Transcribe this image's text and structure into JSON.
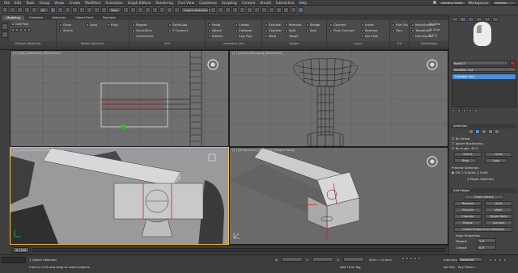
{
  "menubar": {
    "items": [
      "File",
      "Edit",
      "Tools",
      "Group",
      "Views",
      "Create",
      "Modifiers",
      "Animation",
      "Graph Editors",
      "Rendering",
      "Civil View",
      "Customize",
      "Scripting",
      "Content",
      "Arnold",
      "Interactive",
      "Help"
    ],
    "user": "Dmitriy Sivak",
    "workspaces_label": "Workspaces:",
    "workspace": "Default"
  },
  "toolbar": {
    "view_dropdown": "View",
    "selection_set": "Create Selection Se"
  },
  "tabs": [
    "Modeling",
    "Freeform",
    "Selection",
    "Object Paint",
    "Populate"
  ],
  "ribbon": {
    "edit_poly": "Edit Poly",
    "polygon_modeling": "Polygon Modeling",
    "modify_selection_caption": "Modify Selection",
    "edit_caption": "Edit",
    "geometry_caption": "Geometry (All)",
    "edges_caption": "Edges",
    "loops_caption": "Loops",
    "tris_caption": "Tris",
    "subdivision_caption": "Subdivision",
    "align_caption": "Align",
    "grow": "Grow",
    "shrink": "Shrink",
    "loop": "Loop",
    "ring": "Ring",
    "repeat": "Repeat",
    "quickslice": "QuickSlice",
    "swiftloop": "SwiftLoop",
    "p_connect": "P Connect",
    "constraints": "Constraints",
    "relax": "Relax",
    "cut": "Cut",
    "attach": "Attach",
    "detach": "Detach",
    "create": "Create",
    "collapse": "Collapse",
    "cap_poly": "Cap Poly",
    "extrude": "Extrude",
    "chamfer": "Chamfer",
    "weld": "Weld",
    "remove": "Remove",
    "split": "Split",
    "target": "Target",
    "bridge": "Bridge",
    "spin": "Spin",
    "flow_connect": "Flow Connect",
    "connect": "Connect",
    "insert": "Insert",
    "remove_loop": "Remove",
    "set_flow": "Set Flow",
    "edit_tris": "Edit Tris",
    "turn": "Turn",
    "meshsmooth": "MeshSmooth",
    "tessellate": "Tessellate",
    "use_displace": "Use Displac...",
    "make_planar": "Make Planar",
    "to_view": "To View",
    "to_grid": "To Grid",
    "xyz": "X Y Z"
  },
  "viewports": {
    "top_left_label": "[+] [Top] [Standard] [Wireframe]",
    "top_right_label": "[+] [Front] [Standard] [Wireframe]",
    "bottom_left_label": "[+] [Left] [Standard] [Edged Faces]",
    "bottom_right_label": "[+] [Perspective] [Standard] [Edged Faces]"
  },
  "command_panel": {
    "object_name": "Box017",
    "modifier_list_label": "Modifier List",
    "stack_item": "Editable Poly",
    "selection_header": "Selection",
    "by_vertex": "By Vertex",
    "ignore_backfacing": "Ignore Backfacing",
    "by_angle": "By Angle:",
    "by_angle_value": "45.0",
    "shrink": "Shrink",
    "grow": "Grow",
    "ring": "Ring",
    "loop": "Loop",
    "preview_selection": "Preview Selection",
    "off": "Off",
    "subobj": "SubObj",
    "multi": "Multi",
    "status": "4 Edges Selected",
    "edit_edges_header": "Edit Edges",
    "insert_vertex": "Insert Vertex",
    "remove": "Remove",
    "split": "Split",
    "extrude": "Extrude",
    "weld": "Weld",
    "chamfer": "Chamfer",
    "target_weld": "Target Weld",
    "bridge": "Bridge",
    "connect": "Connect",
    "create_shape": "Create Shape From Selection",
    "edge_properties": "Edge Properties",
    "weight": "Weight:",
    "weight_value": "1.0",
    "crease": "Crease:",
    "crease_value": "0.0"
  },
  "timeline": {
    "frame": "0 / 100"
  },
  "statusbar": {
    "selection": "1 Object Selected",
    "prompt": "Click or click-and-drag to select objects",
    "x_label": "X:",
    "y_label": "Y:",
    "z_label": "Z:",
    "grid": "Grid = 10,0cm",
    "add_time_tag": "Add Time Tag",
    "auto_key": "Auto Key",
    "selected": "Selected",
    "set_key": "Set Key",
    "key_filters": "Key Filters..."
  },
  "colors": {
    "accent_blue": "#4a8fd8",
    "selection_red": "#d02020",
    "active_viewport_border": "#e8c23a",
    "green_gizmo": "#3ab23a"
  }
}
